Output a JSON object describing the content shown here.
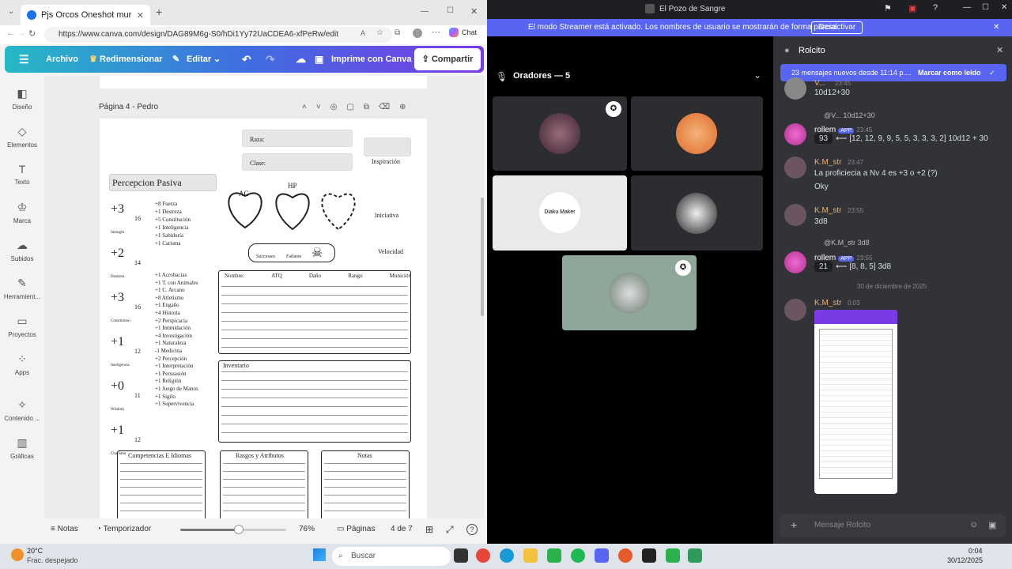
{
  "browser": {
    "tab_title": "Pjs Orcos Oneshot murder hobo",
    "url": "https://www.canva.com/design/DAG89M6g-S0/hDi1Yy72UaCDEA6-xfPeRw/edit",
    "chat_button": "Chat"
  },
  "canva": {
    "menu_icon": "menu-icon",
    "archivo": "Archivo",
    "redimensionar": "Redimensionar",
    "editar": "Editar",
    "imprime": "Imprime con Canva",
    "compartir": "Compartir",
    "sidebar": [
      {
        "label": "Diseño",
        "icon": "layout-icon"
      },
      {
        "label": "Elementos",
        "icon": "shapes-icon"
      },
      {
        "label": "Texto",
        "icon": "text-icon"
      },
      {
        "label": "Marca",
        "icon": "brand-icon"
      },
      {
        "label": "Subidos",
        "icon": "upload-icon"
      },
      {
        "label": "Herramient...",
        "icon": "tools-icon"
      },
      {
        "label": "Proyectos",
        "icon": "folder-icon"
      },
      {
        "label": "Apps",
        "icon": "apps-icon"
      },
      {
        "label": "Contenido ...",
        "icon": "magic-icon"
      },
      {
        "label": "Gráficas",
        "icon": "chart-icon"
      }
    ],
    "page_title": "Página 4 - Pedro",
    "footer": {
      "notas": "Notas",
      "temporizador": "Temporizador",
      "zoom": "76%",
      "paginas": "Páginas",
      "page_count": "4 de 7",
      "zoom_level": 0.55
    }
  },
  "sheet": {
    "raza": "Raza:",
    "clase": "Clase:",
    "inspiracion": "Inspiración",
    "percepcion": "Percepcion Pasiva",
    "ac": "AC",
    "hp": "HP",
    "iniciativa": "Iniciativa",
    "velocidad": "Velocidad",
    "successes": "Successes",
    "failures": "Failures",
    "stats": [
      {
        "mod": "+3",
        "score": "16",
        "label": "Strength"
      },
      {
        "mod": "+2",
        "score": "14",
        "label": "Destreza"
      },
      {
        "mod": "+3",
        "score": "16",
        "label": "Constitution"
      },
      {
        "mod": "+1",
        "score": "12",
        "label": "Inteligencia"
      },
      {
        "mod": "+0",
        "score": "11",
        "label": "Wisdom"
      },
      {
        "mod": "+1",
        "score": "12",
        "label": "Charisma"
      }
    ],
    "saves": [
      {
        "v": "+8",
        "n": "Fuerza"
      },
      {
        "v": "+1",
        "n": "Destreza"
      },
      {
        "v": "+5",
        "n": "Constitución"
      },
      {
        "v": "+1",
        "n": "Inteligencia"
      },
      {
        "v": "+1",
        "n": "Sabiduría"
      },
      {
        "v": "+1",
        "n": "Carisma"
      }
    ],
    "skills": [
      {
        "v": "+1",
        "n": "Acrobacias"
      },
      {
        "v": "+1",
        "n": "T. con Animales"
      },
      {
        "v": "+1",
        "n": "C. Arcano"
      },
      {
        "v": "+8",
        "n": "Atletismo"
      },
      {
        "v": "+1",
        "n": "Engaño"
      },
      {
        "v": "+4",
        "n": "Historia"
      },
      {
        "v": "+2",
        "n": "Perspicacia"
      },
      {
        "v": "+1",
        "n": "Intimidación"
      },
      {
        "v": "+4",
        "n": "Investigación"
      },
      {
        "v": "+1",
        "n": "Naturaleza"
      },
      {
        "v": "-1",
        "n": "Medicina"
      },
      {
        "v": "+2",
        "n": "Percepción"
      },
      {
        "v": "+1",
        "n": "Interpretación"
      },
      {
        "v": "+1",
        "n": "Persuasión"
      },
      {
        "v": "+1",
        "n": "Religión"
      },
      {
        "v": "+1",
        "n": "Juego de Manos"
      },
      {
        "v": "+1",
        "n": "Sigilo"
      },
      {
        "v": "+1",
        "n": "Supervivencia"
      }
    ],
    "attack_headers": [
      "Nombre:",
      "ATQ",
      "Daño",
      "Rango",
      "Munición"
    ],
    "inventario": "Inventario",
    "bottom_boxes": [
      "Competencias E Idiomas",
      "Rasgos y Atributos",
      "Notas"
    ]
  },
  "discord": {
    "window_title": "El Pozo de Sangre",
    "streamer_banner": "El modo Streamer está activado. Los nombres de usuario se mostrarán de forma parcial.",
    "desactivar": "Desactivar",
    "speakers": "Oradores — 5",
    "tile_label": "Diaku Maker",
    "channel": "Rolcito",
    "new_messages": "23 mensajes nuevos desde 11:14 p....",
    "mark_read": "Marcar como leído",
    "messages": [
      {
        "user": "V...",
        "time": "23:45",
        "text": "10d12+30"
      },
      {
        "reply": "@V... 10d12+30",
        "user": "rollem",
        "badge": "APP",
        "time": "23:45",
        "result": "93",
        "detail": "⟵ [12, 12, 9, 9, 5, 5, 3, 3, 3, 2] 10d12 + 30"
      },
      {
        "user": "K.M_str",
        "time": "23:47",
        "text": "La proficiecia a Nv 4 es +3 o +2 (?)",
        "text2": "Oky"
      },
      {
        "user": "K.M_str",
        "time": "23:55",
        "text": "3d8"
      },
      {
        "reply": "@K.M_str 3d8",
        "user": "rollem",
        "badge": "APP",
        "time": "23:55",
        "result": "21",
        "detail": "⟵ [8, 8, 5] 3d8"
      },
      {
        "date": "30 de diciembre de 2025"
      },
      {
        "user": "K.M_str",
        "time": "0:03"
      }
    ],
    "input_placeholder": "Mensaje Rolcito"
  },
  "taskbar": {
    "weather_temp": "20°C",
    "weather_desc": "Frac. despejado",
    "search": "Buscar",
    "time": "0:04",
    "date": "30/12/2025"
  },
  "colors": {
    "canva_gradient_start": "#27b9c6",
    "canva_gradient_end": "#7a3be6",
    "discord_blurple": "#5865f2",
    "username": "#e9b47a"
  }
}
